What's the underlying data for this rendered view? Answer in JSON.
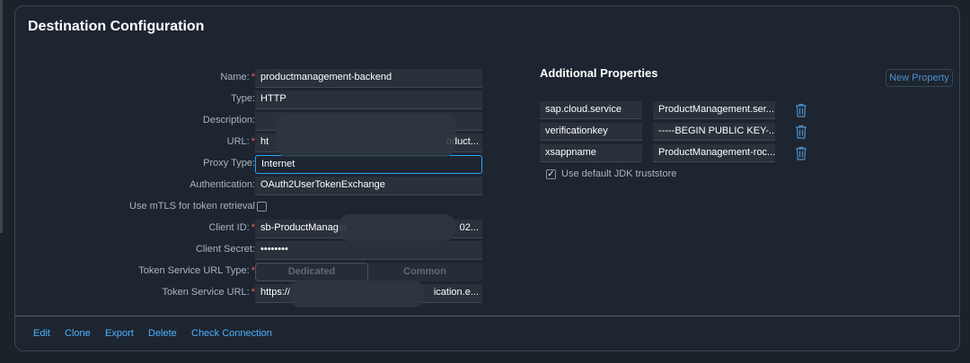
{
  "panel": {
    "title": "Destination Configuration"
  },
  "form": {
    "name": {
      "label": "Name:",
      "value": "productmanagement-backend",
      "required": "*"
    },
    "type": {
      "label": "Type:",
      "value": "HTTP"
    },
    "description": {
      "label": "Description:",
      "value": ""
    },
    "url": {
      "label": "URL:",
      "value": "ht",
      "value_tail": "oduct...",
      "required": "*"
    },
    "proxy_type": {
      "label": "Proxy Type:",
      "value": "Internet"
    },
    "authentication": {
      "label": "Authentication:",
      "value": "OAuth2UserTokenExchange"
    },
    "mtls": {
      "label": "Use mTLS for token retrieval"
    },
    "client_id": {
      "label": "Client ID:",
      "value": "sb-ProductManager",
      "value_tail": "02...",
      "required": "*"
    },
    "client_secret": {
      "label": "Client Secret:",
      "value": "••••••••"
    },
    "token_service_url_type": {
      "label": "Token Service URL Type:",
      "required": "*",
      "options": [
        "Dedicated",
        "Common"
      ],
      "selected": "Dedicated"
    },
    "token_service_url": {
      "label": "Token Service URL:",
      "value": "https://",
      "value_tail": "ication.e...",
      "required": "*"
    }
  },
  "additional_properties": {
    "title": "Additional Properties",
    "new_button": "New Property",
    "rows": [
      {
        "key": "sap.cloud.service",
        "value": "ProductManagement.ser..."
      },
      {
        "key": "verificationkey",
        "value": "-----BEGIN PUBLIC KEY-..."
      },
      {
        "key": "xsappname",
        "value": "ProductManagement-roc..."
      }
    ],
    "jdk_truststore": {
      "label": "Use default JDK truststore",
      "checked": true,
      "check_glyph": "✓"
    }
  },
  "footer": {
    "buttons": [
      "Edit",
      "Clone",
      "Export",
      "Delete",
      "Check Connection"
    ]
  },
  "colors": {
    "accent_link": "#4db1ff",
    "required": "#ff5e5e",
    "focus_border": "#2aa3f5",
    "panel_bg": "#1d2530"
  },
  "icons": {
    "delete": "trash-icon",
    "check": "checkmark-icon"
  }
}
